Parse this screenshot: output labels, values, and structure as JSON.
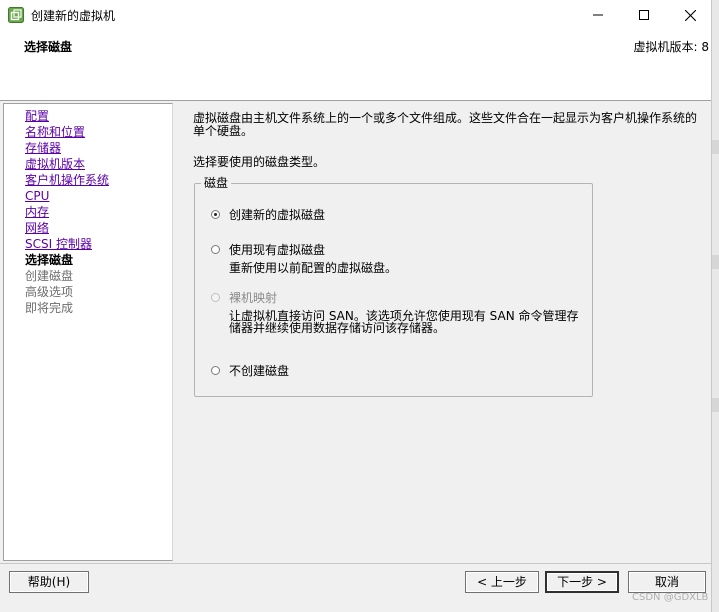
{
  "window": {
    "title": "创建新的虚拟机",
    "icon": "vm-wizard-icon",
    "controls": [
      "minimize-icon",
      "maximize-icon",
      "close-icon"
    ]
  },
  "header": {
    "title": "选择磁盘",
    "version": "虚拟机版本: 8"
  },
  "steps": [
    {
      "label": "配置",
      "state": "done"
    },
    {
      "label": "名称和位置",
      "state": "done"
    },
    {
      "label": "存储器",
      "state": "done"
    },
    {
      "label": "虚拟机版本",
      "state": "done"
    },
    {
      "label": "客户机操作系统",
      "state": "done"
    },
    {
      "label": "CPU",
      "state": "done"
    },
    {
      "label": "内存",
      "state": "done"
    },
    {
      "label": "网络",
      "state": "done"
    },
    {
      "label": "SCSI 控制器",
      "state": "done"
    },
    {
      "label": "选择磁盘",
      "state": "current"
    },
    {
      "label": "创建磁盘",
      "state": "future"
    },
    {
      "label": "高级选项",
      "state": "future"
    },
    {
      "label": "即将完成",
      "state": "future"
    }
  ],
  "main": {
    "description": "虚拟磁盘由主机文件系统上的一个或多个文件组成。这些文件合在一起显示为客户机操作系统的单个硬盘。",
    "prompt": "选择要使用的磁盘类型。",
    "group_label": "磁盘",
    "options": {
      "create_new": {
        "label": "创建新的虚拟磁盘",
        "checked": true
      },
      "use_existing": {
        "label": "使用现有虚拟磁盘",
        "sub": "重新使用以前配置的虚拟磁盘。",
        "checked": false
      },
      "raw_mapping": {
        "label": "裸机映射",
        "sub": "让虚拟机直接访问 SAN。该选项允许您使用现有 SAN 命令管理存储器并继续使用数据存储访问该存储器。",
        "checked": false,
        "disabled": true
      },
      "no_disk": {
        "label": "不创建磁盘",
        "checked": false
      }
    }
  },
  "footer": {
    "help": "帮助(H)",
    "back": "< 上一步",
    "next": "下一步 >",
    "cancel": "取消"
  },
  "watermark": "CSDN @GDXLB"
}
